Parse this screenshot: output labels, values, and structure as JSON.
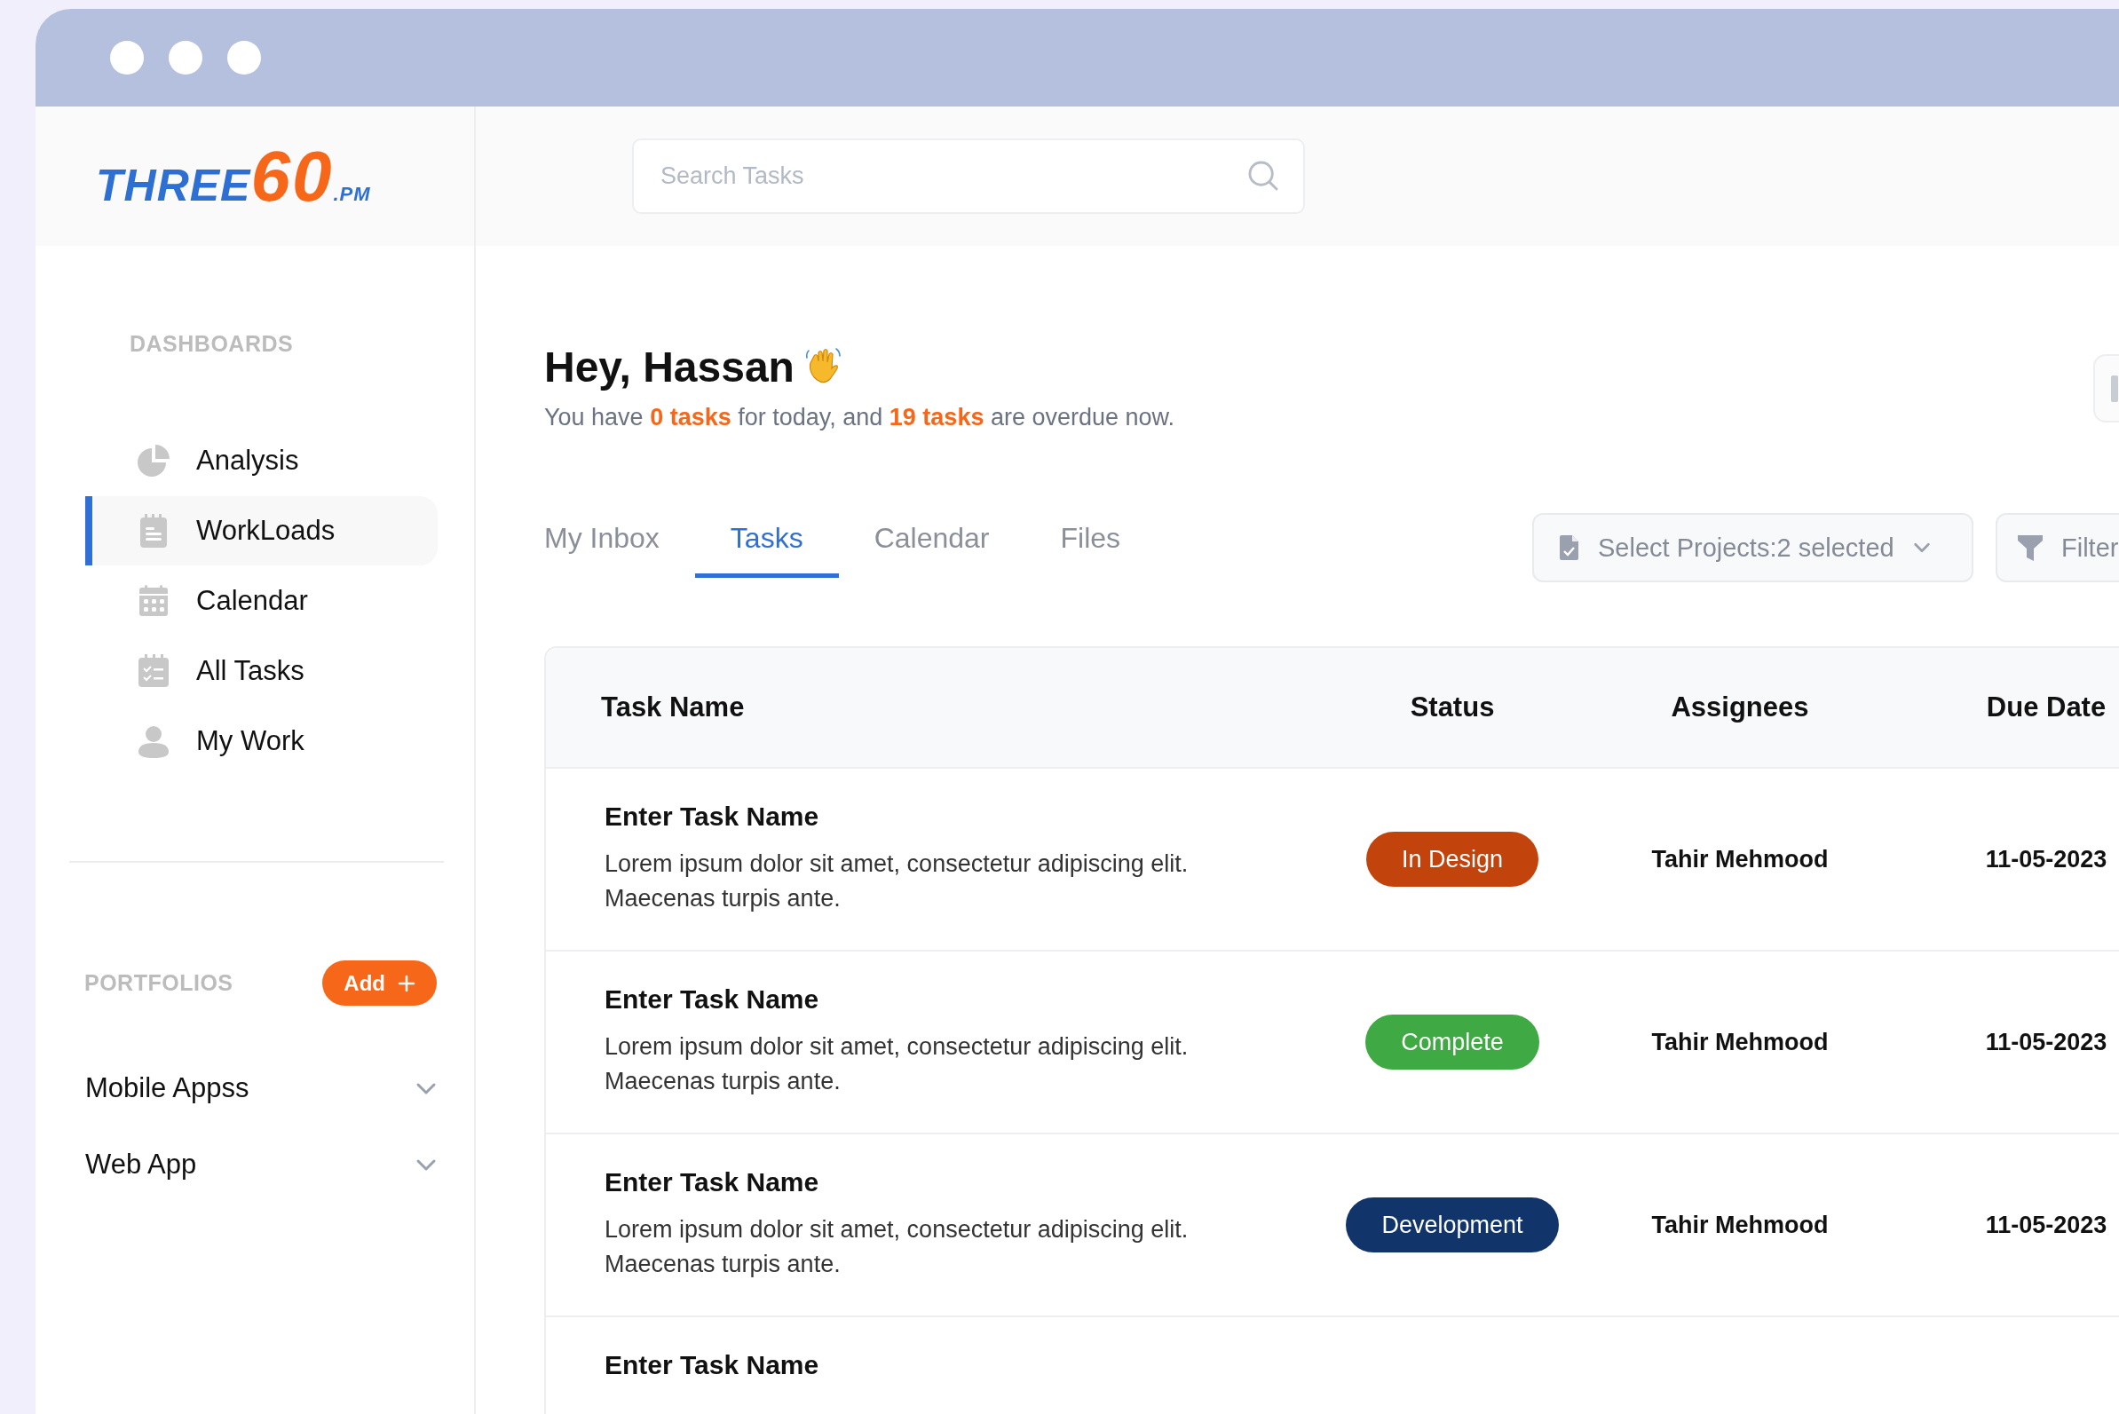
{
  "logo": {
    "parts": [
      "THREE",
      "60",
      ".PM"
    ]
  },
  "search": {
    "placeholder": "Search Tasks"
  },
  "sidebar": {
    "dashboards_heading": "DASHBOARDS",
    "items": [
      {
        "label": "Analysis",
        "selected": false
      },
      {
        "label": "WorkLoads",
        "selected": true
      },
      {
        "label": "Calendar",
        "selected": false
      },
      {
        "label": "All Tasks",
        "selected": false
      },
      {
        "label": "My Work",
        "selected": false
      }
    ],
    "portfolios_heading": "PORTFOLIOS",
    "add_button": "Add",
    "portfolios": [
      {
        "label": "Mobile Appss",
        "expanded": false
      },
      {
        "label": "Web App",
        "expanded": false
      }
    ]
  },
  "greeting": {
    "title": "Hey, Hassan",
    "subtitle": [
      {
        "text": "You have ",
        "highlight": false
      },
      {
        "text": "0 tasks",
        "highlight": true
      },
      {
        "text": " for today, and ",
        "highlight": false
      },
      {
        "text": "19 tasks",
        "highlight": true
      },
      {
        "text": " are overdue now.",
        "highlight": false
      }
    ]
  },
  "tabs": [
    {
      "label": "My Inbox",
      "selected": false
    },
    {
      "label": "Tasks",
      "selected": true
    },
    {
      "label": "Calendar",
      "selected": false
    },
    {
      "label": "Files",
      "selected": false
    }
  ],
  "project_select": "Select Projects:2 selected",
  "filter_button": "Filter",
  "table": {
    "columns": [
      "Task Name",
      "Status",
      "Assignees",
      "Due Date"
    ],
    "rows": [
      {
        "task_name": "Enter Task Name",
        "description": "Lorem ipsum dolor sit amet, consectetur adipiscing elit. Maecenas turpis ante.",
        "status": "In Design",
        "color": "#c2440c",
        "assignee": "Tahir Mehmood",
        "due_date": "11-05-2023"
      },
      {
        "task_name": "Enter Task Name",
        "description": "Lorem ipsum dolor sit amet, consectetur adipiscing elit. Maecenas turpis ante.",
        "status": "Complete",
        "color": "#3fa944",
        "assignee": "Tahir Mehmood",
        "due_date": "11-05-2023"
      },
      {
        "task_name": "Enter Task Name",
        "description": "Lorem ipsum dolor sit amet, consectetur adipiscing elit. Maecenas turpis ante.",
        "status": "Development",
        "color": "#11356b",
        "assignee": "Tahir Mehmood",
        "due_date": "11-05-2023"
      },
      {
        "task_name": "Enter Task Name"
      }
    ]
  }
}
